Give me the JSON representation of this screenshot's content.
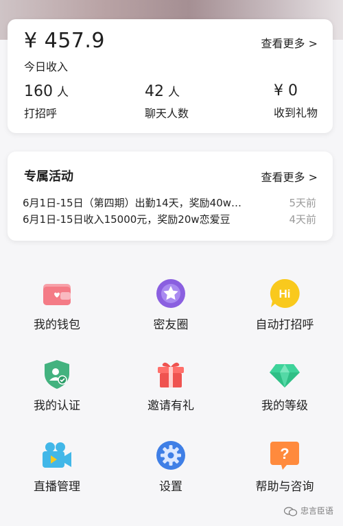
{
  "income": {
    "amount": "¥ 457.9",
    "amount_label": "今日收入",
    "more_label": "查看更多 >",
    "stats": [
      {
        "value": "160",
        "unit": "人",
        "label": "打招呼"
      },
      {
        "value": "42",
        "unit": "人",
        "label": "聊天人数"
      },
      {
        "value": "¥ 0",
        "unit": "",
        "label": "收到礼物"
      }
    ]
  },
  "activity": {
    "title": "专属活动",
    "more_label": "查看更多 >",
    "items": [
      {
        "text": "6月1日-15日（第四期）出勤14天，奖励40w…",
        "time": "5天前"
      },
      {
        "text": "6月1日-15日收入15000元，奖励20w恋爱豆",
        "time": "4天前"
      }
    ]
  },
  "menu": [
    {
      "label": "我的钱包",
      "icon": "wallet-icon"
    },
    {
      "label": "密友圈",
      "icon": "star-badge-icon"
    },
    {
      "label": "自动打招呼",
      "icon": "hi-icon"
    },
    {
      "label": "我的认证",
      "icon": "shield-user-icon"
    },
    {
      "label": "邀请有礼",
      "icon": "gift-icon"
    },
    {
      "label": "我的等级",
      "icon": "diamond-icon"
    },
    {
      "label": "直播管理",
      "icon": "video-camera-icon"
    },
    {
      "label": "设置",
      "icon": "gear-icon"
    },
    {
      "label": "帮助与咨询",
      "icon": "question-icon"
    }
  ],
  "watermark": {
    "text": "忠言臣语"
  },
  "colors": {
    "background": "#f6f6f8",
    "card": "#ffffff",
    "text_primary": "#222222",
    "text_secondary": "#9a9a9a",
    "wallet": "#f47b86",
    "star": "#8a5fe0",
    "hi": "#f9c91d",
    "shield": "#43b27f",
    "gift": "#ef5350",
    "diamond": "#3ed39a",
    "camera": "#42b7e8",
    "gear": "#3f7fe6",
    "question": "#ff8a3d"
  }
}
